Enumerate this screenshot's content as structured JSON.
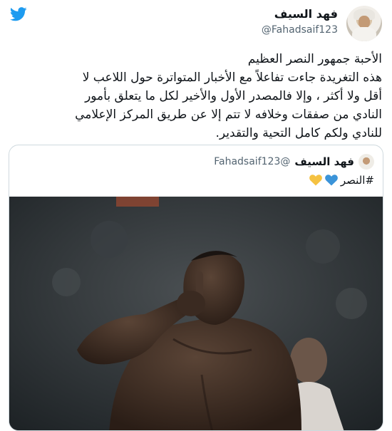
{
  "app": {
    "logo_icon": "twitter-bird-icon",
    "brand_color": "#1d9bf0"
  },
  "tweet": {
    "author_name": "فهد السيف",
    "author_handle": "@Fahadsaif123",
    "lines": [
      "الأحبة جمهور النصر العظيم",
      "هذه التغريدة جاءت تفاعلاً مع الأخبار المتواترة حول اللاعب لا",
      "أقل ولا أكثر ، وإلا فالمصدر الأول والأخير لكل ما يتعلق بأمور",
      "النادي من صفقات وخلافه لا تتم إلا عن طريق المركز الإعلامي",
      "للنادي ولكم كامل التحية والتقدير."
    ]
  },
  "quoted_tweet": {
    "author_name": "فهد السيف",
    "author_handle": "@Fahadsaif123",
    "hashtag": "#النصر",
    "emojis": [
      "blue-heart-icon",
      "yellow-heart-icon"
    ],
    "emoji_colors": [
      "#3b94d9",
      "#f5c242"
    ],
    "photo_description_icon": "player-shush-photo"
  }
}
